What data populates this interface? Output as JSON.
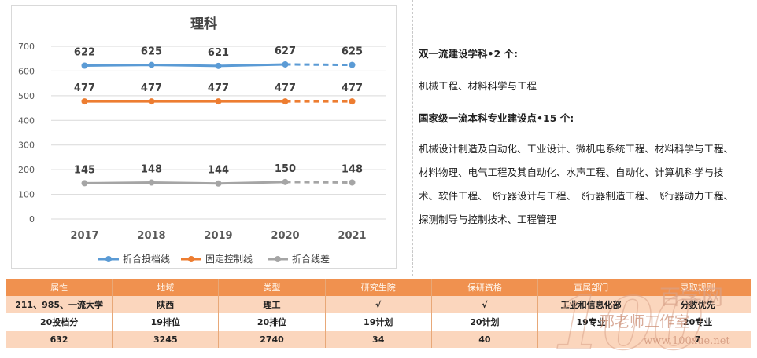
{
  "chart_data": {
    "type": "line",
    "title": "理科",
    "categories": [
      "2017",
      "2018",
      "2019",
      "2020",
      "2021"
    ],
    "ylim": [
      0,
      700
    ],
    "yticks": [
      0,
      100,
      200,
      300,
      400,
      500,
      600,
      700
    ],
    "grid": true,
    "legend_position": "bottom",
    "dashed_from_index": 3,
    "series": [
      {
        "name": "折合投档线",
        "values": [
          622,
          625,
          621,
          627,
          625
        ],
        "labels": [
          "622",
          "625",
          "621",
          "627",
          "625"
        ],
        "color": "#5b9bd5"
      },
      {
        "name": "固定控制线",
        "values": [
          477,
          477,
          477,
          477,
          477
        ],
        "labels": [
          "477",
          "477",
          "477",
          "477",
          "477"
        ],
        "color": "#ed7d31"
      },
      {
        "name": "折合线差",
        "values": [
          145,
          148,
          144,
          150,
          148
        ],
        "labels": [
          "145",
          "148",
          "144",
          "150",
          "148"
        ],
        "color": "#a5a5a5"
      }
    ]
  },
  "notes": {
    "heading1": "双一流建设学科•2 个:",
    "line1": "机械工程、材料科学与工程",
    "heading2": "国家级一流本科专业建设点•15 个:",
    "lines": [
      "机械设计制造及自动化、工业设计、微机电系统工程、材料科学与工程、",
      "材料物理、电气工程及其自动化、水声工程、自动化、计算机科学与技",
      "术、软件工程、飞行器设计与工程、飞行器制造工程、飞行器动力工程、",
      "探测制导与控制技术、工程管理"
    ]
  },
  "table": {
    "headers": [
      "属性",
      "地域",
      "类型",
      "研究生院",
      "保研资格",
      "直属部门",
      "录取规则"
    ],
    "rows": [
      [
        "211、985、一流大学",
        "陕西",
        "理工",
        "√",
        "√",
        "工业和信息化部",
        "分数优先"
      ],
      [
        "20投档分",
        "19排位",
        "20排位",
        "19计划",
        "20计划",
        "19专业",
        "20专业"
      ],
      [
        "632",
        "3245",
        "2740",
        "34",
        "40",
        "",
        "7"
      ]
    ]
  },
  "watermark": {
    "digits": "100",
    "brand": "百学网",
    "studio": "邢老师工作室",
    "url": "www.100xue.net",
    "color": "#d9a38a"
  }
}
